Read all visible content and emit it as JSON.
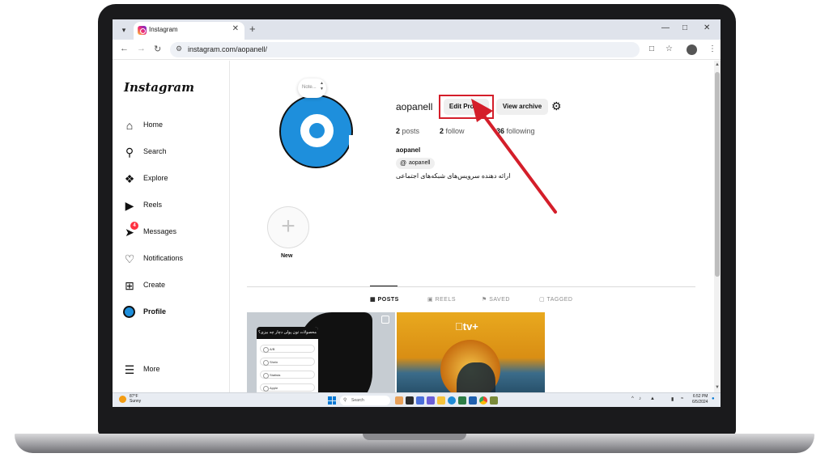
{
  "browser": {
    "tab_title": "Instagram",
    "url": "instagram.com/aopanell/"
  },
  "sidebar": {
    "logo": "Instagram",
    "items": [
      {
        "label": "Home",
        "icon": "home-icon"
      },
      {
        "label": "Search",
        "icon": "search-icon"
      },
      {
        "label": "Explore",
        "icon": "compass-icon"
      },
      {
        "label": "Reels",
        "icon": "reels-icon"
      },
      {
        "label": "Messages",
        "icon": "messenger-icon",
        "badge": "4"
      },
      {
        "label": "Notifications",
        "icon": "heart-icon"
      },
      {
        "label": "Create",
        "icon": "plus-square-icon"
      },
      {
        "label": "Profile",
        "icon": "avatar"
      },
      {
        "label": "More",
        "icon": "menu-icon"
      }
    ]
  },
  "profile": {
    "note_placeholder": "Note...",
    "username": "aopanell",
    "edit_profile_label": "Edit Profile",
    "view_archive_label": "View archive",
    "posts_count": "2",
    "posts_label": "posts",
    "followers_count": "2",
    "followers_label": "follow",
    "following_count": "36",
    "following_label": "following",
    "display_name": "aopanel",
    "threads_handle": "aopanell",
    "bio": "ارائه دهنده سرویس‌های شبکه‌های اجتماعی"
  },
  "highlights": {
    "new_label": "New"
  },
  "profile_tabs": [
    {
      "label": "POSTS",
      "icon": "grid-icon",
      "active": true
    },
    {
      "label": "REELS",
      "icon": "reels-icon",
      "active": false
    },
    {
      "label": "SAVED",
      "icon": "bookmark-icon",
      "active": false
    },
    {
      "label": "TAGGED",
      "icon": "tag-icon",
      "active": false
    }
  ],
  "posts": {
    "post1_title": "محصولات تون پولی‌ دچار چه‌ ‌بیزی؟",
    "post1_options": [
      "A/B",
      "Shein",
      "Statista",
      "Apple"
    ],
    "post2_logo": "tv+"
  },
  "taskbar": {
    "weather_temp": "87°F",
    "weather_desc": "Sunny",
    "search_placeholder": "Search",
    "time": "6:52 PM",
    "date": "6/5/2024"
  },
  "annotation": {
    "highlight_color": "#d41e2a"
  }
}
